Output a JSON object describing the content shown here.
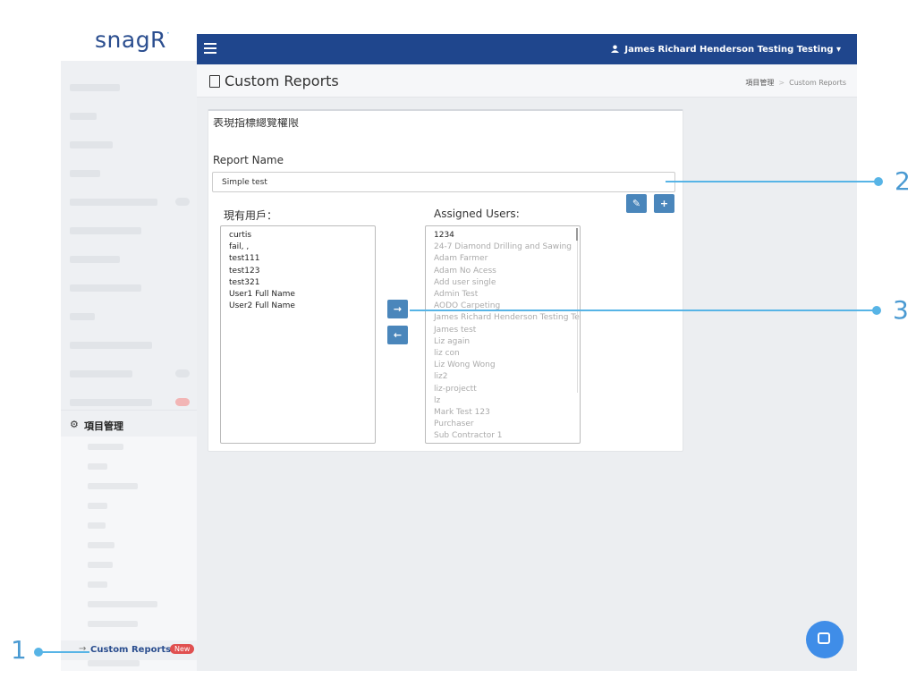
{
  "brand": {
    "logo": "snagR"
  },
  "topbar": {
    "user": "James Richard Henderson Testing Testing ▾"
  },
  "sidebar": {
    "section": "項目管理",
    "active_item": {
      "label": "Custom Reports",
      "badge": "New"
    }
  },
  "page": {
    "title": "Custom Reports",
    "breadcrumb": {
      "parent": "項目管理",
      "current": "Custom Reports"
    }
  },
  "form": {
    "panel_title": "表現指標總覽權限",
    "report_name_label": "Report Name",
    "report_name_value": "Simple test",
    "edit_icon": "✎",
    "add_icon": "+"
  },
  "existing_users": {
    "title": "現有用戶：",
    "items": [
      "curtis",
      "fail, ,",
      "test111",
      "test123",
      "test321",
      "User1 Full Name",
      "User2 Full Name"
    ]
  },
  "assigned_users": {
    "title": "Assigned Users:",
    "items": [
      "1234",
      "24-7 Diamond Drilling and Sawing",
      "Adam Farmer",
      "Adam No Acess",
      "Add user single",
      "Admin Test",
      "AODO Carpeting",
      "James Richard Henderson Testing Testing",
      "James test",
      "Liz again",
      "liz con",
      "Liz Wong Wong",
      "liz2",
      "liz-projectt",
      "lz",
      "Mark Test 123",
      "Purchaser",
      "Sub Contractor 1"
    ]
  },
  "transfer": {
    "add": "→",
    "remove": "←"
  },
  "callouts": [
    "1",
    "2",
    "3"
  ],
  "colors": {
    "topbar": "#1f468d",
    "button": "#4a86bb",
    "callout": "#57b4e6",
    "badge": "#e05050"
  }
}
